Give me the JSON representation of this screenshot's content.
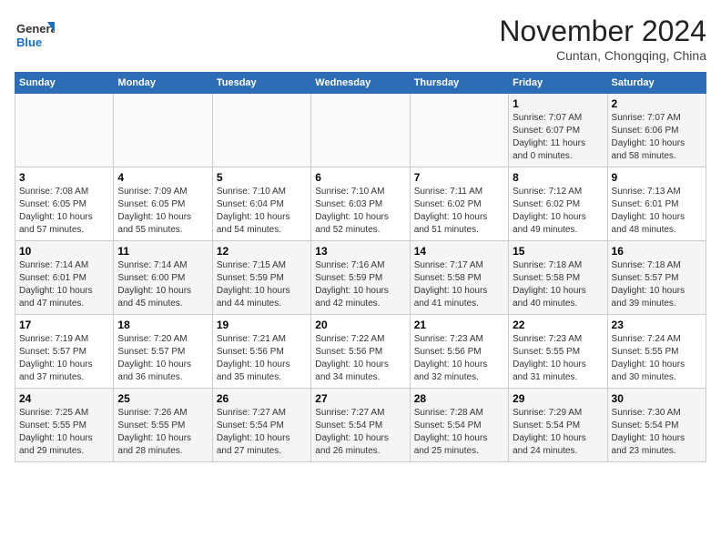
{
  "header": {
    "logo_line1": "General",
    "logo_line2": "Blue",
    "month": "November 2024",
    "location": "Cuntan, Chongqing, China"
  },
  "weekdays": [
    "Sunday",
    "Monday",
    "Tuesday",
    "Wednesday",
    "Thursday",
    "Friday",
    "Saturday"
  ],
  "weeks": [
    [
      {
        "day": "",
        "info": ""
      },
      {
        "day": "",
        "info": ""
      },
      {
        "day": "",
        "info": ""
      },
      {
        "day": "",
        "info": ""
      },
      {
        "day": "",
        "info": ""
      },
      {
        "day": "1",
        "info": "Sunrise: 7:07 AM\nSunset: 6:07 PM\nDaylight: 11 hours\nand 0 minutes."
      },
      {
        "day": "2",
        "info": "Sunrise: 7:07 AM\nSunset: 6:06 PM\nDaylight: 10 hours\nand 58 minutes."
      }
    ],
    [
      {
        "day": "3",
        "info": "Sunrise: 7:08 AM\nSunset: 6:05 PM\nDaylight: 10 hours\nand 57 minutes."
      },
      {
        "day": "4",
        "info": "Sunrise: 7:09 AM\nSunset: 6:05 PM\nDaylight: 10 hours\nand 55 minutes."
      },
      {
        "day": "5",
        "info": "Sunrise: 7:10 AM\nSunset: 6:04 PM\nDaylight: 10 hours\nand 54 minutes."
      },
      {
        "day": "6",
        "info": "Sunrise: 7:10 AM\nSunset: 6:03 PM\nDaylight: 10 hours\nand 52 minutes."
      },
      {
        "day": "7",
        "info": "Sunrise: 7:11 AM\nSunset: 6:02 PM\nDaylight: 10 hours\nand 51 minutes."
      },
      {
        "day": "8",
        "info": "Sunrise: 7:12 AM\nSunset: 6:02 PM\nDaylight: 10 hours\nand 49 minutes."
      },
      {
        "day": "9",
        "info": "Sunrise: 7:13 AM\nSunset: 6:01 PM\nDaylight: 10 hours\nand 48 minutes."
      }
    ],
    [
      {
        "day": "10",
        "info": "Sunrise: 7:14 AM\nSunset: 6:01 PM\nDaylight: 10 hours\nand 47 minutes."
      },
      {
        "day": "11",
        "info": "Sunrise: 7:14 AM\nSunset: 6:00 PM\nDaylight: 10 hours\nand 45 minutes."
      },
      {
        "day": "12",
        "info": "Sunrise: 7:15 AM\nSunset: 5:59 PM\nDaylight: 10 hours\nand 44 minutes."
      },
      {
        "day": "13",
        "info": "Sunrise: 7:16 AM\nSunset: 5:59 PM\nDaylight: 10 hours\nand 42 minutes."
      },
      {
        "day": "14",
        "info": "Sunrise: 7:17 AM\nSunset: 5:58 PM\nDaylight: 10 hours\nand 41 minutes."
      },
      {
        "day": "15",
        "info": "Sunrise: 7:18 AM\nSunset: 5:58 PM\nDaylight: 10 hours\nand 40 minutes."
      },
      {
        "day": "16",
        "info": "Sunrise: 7:18 AM\nSunset: 5:57 PM\nDaylight: 10 hours\nand 39 minutes."
      }
    ],
    [
      {
        "day": "17",
        "info": "Sunrise: 7:19 AM\nSunset: 5:57 PM\nDaylight: 10 hours\nand 37 minutes."
      },
      {
        "day": "18",
        "info": "Sunrise: 7:20 AM\nSunset: 5:57 PM\nDaylight: 10 hours\nand 36 minutes."
      },
      {
        "day": "19",
        "info": "Sunrise: 7:21 AM\nSunset: 5:56 PM\nDaylight: 10 hours\nand 35 minutes."
      },
      {
        "day": "20",
        "info": "Sunrise: 7:22 AM\nSunset: 5:56 PM\nDaylight: 10 hours\nand 34 minutes."
      },
      {
        "day": "21",
        "info": "Sunrise: 7:23 AM\nSunset: 5:56 PM\nDaylight: 10 hours\nand 32 minutes."
      },
      {
        "day": "22",
        "info": "Sunrise: 7:23 AM\nSunset: 5:55 PM\nDaylight: 10 hours\nand 31 minutes."
      },
      {
        "day": "23",
        "info": "Sunrise: 7:24 AM\nSunset: 5:55 PM\nDaylight: 10 hours\nand 30 minutes."
      }
    ],
    [
      {
        "day": "24",
        "info": "Sunrise: 7:25 AM\nSunset: 5:55 PM\nDaylight: 10 hours\nand 29 minutes."
      },
      {
        "day": "25",
        "info": "Sunrise: 7:26 AM\nSunset: 5:55 PM\nDaylight: 10 hours\nand 28 minutes."
      },
      {
        "day": "26",
        "info": "Sunrise: 7:27 AM\nSunset: 5:54 PM\nDaylight: 10 hours\nand 27 minutes."
      },
      {
        "day": "27",
        "info": "Sunrise: 7:27 AM\nSunset: 5:54 PM\nDaylight: 10 hours\nand 26 minutes."
      },
      {
        "day": "28",
        "info": "Sunrise: 7:28 AM\nSunset: 5:54 PM\nDaylight: 10 hours\nand 25 minutes."
      },
      {
        "day": "29",
        "info": "Sunrise: 7:29 AM\nSunset: 5:54 PM\nDaylight: 10 hours\nand 24 minutes."
      },
      {
        "day": "30",
        "info": "Sunrise: 7:30 AM\nSunset: 5:54 PM\nDaylight: 10 hours\nand 23 minutes."
      }
    ]
  ]
}
